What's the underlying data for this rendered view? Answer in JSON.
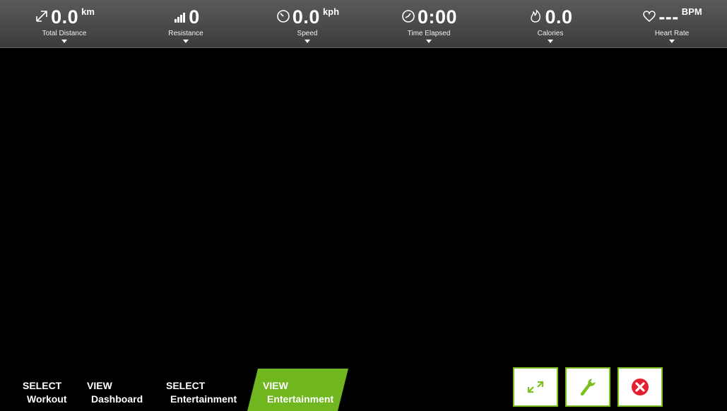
{
  "metrics": [
    {
      "id": "distance",
      "icon": "expand-arrow-icon",
      "value": "0.0",
      "unit": "km",
      "label": "Total Distance"
    },
    {
      "id": "resistance",
      "icon": "signal-bars-icon",
      "value": "0",
      "unit": "",
      "label": "Resistance"
    },
    {
      "id": "speed",
      "icon": "speedometer-icon",
      "value": "0.0",
      "unit": "kph",
      "label": "Speed"
    },
    {
      "id": "time",
      "icon": "clock-icon",
      "value": "0:00",
      "unit": "",
      "label": "Time Elapsed"
    },
    {
      "id": "calories",
      "icon": "flame-icon",
      "value": "0.0",
      "unit": "",
      "label": "Calories"
    },
    {
      "id": "heartrate",
      "icon": "heart-icon",
      "value": "---",
      "unit": "BPM",
      "label": "Heart Rate"
    }
  ],
  "nav": [
    {
      "line1": "SELECT",
      "line2": "Workout",
      "active": false
    },
    {
      "line1": "VIEW",
      "line2": "Dashboard",
      "active": false
    },
    {
      "line1": "SELECT",
      "line2": "Entertainment",
      "active": false
    },
    {
      "line1": "VIEW",
      "line2": "Entertainment",
      "active": true
    }
  ],
  "actions": [
    {
      "icon": "fullscreen-icon"
    },
    {
      "icon": "wrench-icon"
    },
    {
      "icon": "close-icon"
    }
  ],
  "colors": {
    "accent": "#6fb61f",
    "topbar": "#4a4a4a",
    "close_red": "#e5202e"
  }
}
